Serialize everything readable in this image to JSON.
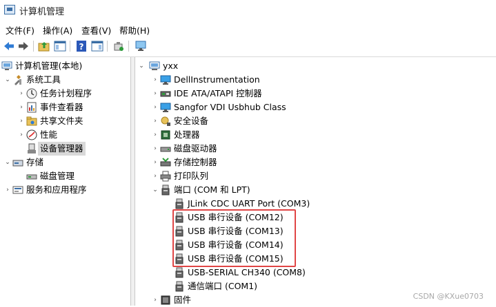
{
  "window": {
    "title": "计算机管理"
  },
  "menu": [
    "文件(F)",
    "操作(A)",
    "查看(V)",
    "帮助(H)"
  ],
  "left_tree": [
    {
      "label": "计算机管理(本地)",
      "expander": "",
      "icon": "computer-management-icon"
    },
    {
      "label": "系统工具",
      "expander": "open",
      "icon": "tools-icon"
    },
    {
      "label": "任务计划程序",
      "expander": "closed",
      "icon": "clock-icon"
    },
    {
      "label": "事件查看器",
      "expander": "closed",
      "icon": "event-viewer-icon"
    },
    {
      "label": "共享文件夹",
      "expander": "closed",
      "icon": "shared-folder-icon"
    },
    {
      "label": "性能",
      "expander": "closed",
      "icon": "performance-icon"
    },
    {
      "label": "设备管理器",
      "expander": "",
      "icon": "device-manager-icon",
      "selected": true
    },
    {
      "label": "存储",
      "expander": "open",
      "icon": "storage-icon"
    },
    {
      "label": "磁盘管理",
      "expander": "",
      "icon": "disk-icon"
    },
    {
      "label": "服务和应用程序",
      "expander": "closed",
      "icon": "services-icon"
    }
  ],
  "right_tree": [
    {
      "label": "yxx",
      "expander": "open",
      "icon": "computer-icon"
    },
    {
      "label": "DellInstrumentation",
      "expander": "closed",
      "icon": "monitor-icon"
    },
    {
      "label": "IDE ATA/ATAPI 控制器",
      "expander": "closed",
      "icon": "ide-controller-icon"
    },
    {
      "label": "Sangfor VDI Usbhub Class",
      "expander": "closed",
      "icon": "monitor-icon"
    },
    {
      "label": "安全设备",
      "expander": "closed",
      "icon": "security-device-icon"
    },
    {
      "label": "处理器",
      "expander": "closed",
      "icon": "processor-icon"
    },
    {
      "label": "磁盘驱动器",
      "expander": "closed",
      "icon": "disk-drive-icon"
    },
    {
      "label": "存储控制器",
      "expander": "closed",
      "icon": "storage-controller-icon"
    },
    {
      "label": "打印队列",
      "expander": "closed",
      "icon": "printer-icon"
    },
    {
      "label": "端口 (COM 和 LPT)",
      "expander": "open",
      "icon": "port-icon"
    },
    {
      "label": "JLink CDC UART Port (COM3)",
      "expander": "",
      "icon": "port-icon"
    },
    {
      "label": "USB 串行设备 (COM12)",
      "expander": "",
      "icon": "port-icon"
    },
    {
      "label": "USB 串行设备 (COM13)",
      "expander": "",
      "icon": "port-icon"
    },
    {
      "label": "USB 串行设备 (COM14)",
      "expander": "",
      "icon": "port-icon"
    },
    {
      "label": "USB 串行设备 (COM15)",
      "expander": "",
      "icon": "port-icon"
    },
    {
      "label": "USB-SERIAL CH340 (COM8)",
      "expander": "",
      "icon": "port-icon"
    },
    {
      "label": "通信端口 (COM1)",
      "expander": "",
      "icon": "port-icon"
    },
    {
      "label": "固件",
      "expander": "closed",
      "icon": "firmware-icon"
    }
  ],
  "watermark": "CSDN @KXue0703",
  "colors": {
    "highlight_border": "#e04545",
    "selection_bg": "#d9d9d9"
  }
}
